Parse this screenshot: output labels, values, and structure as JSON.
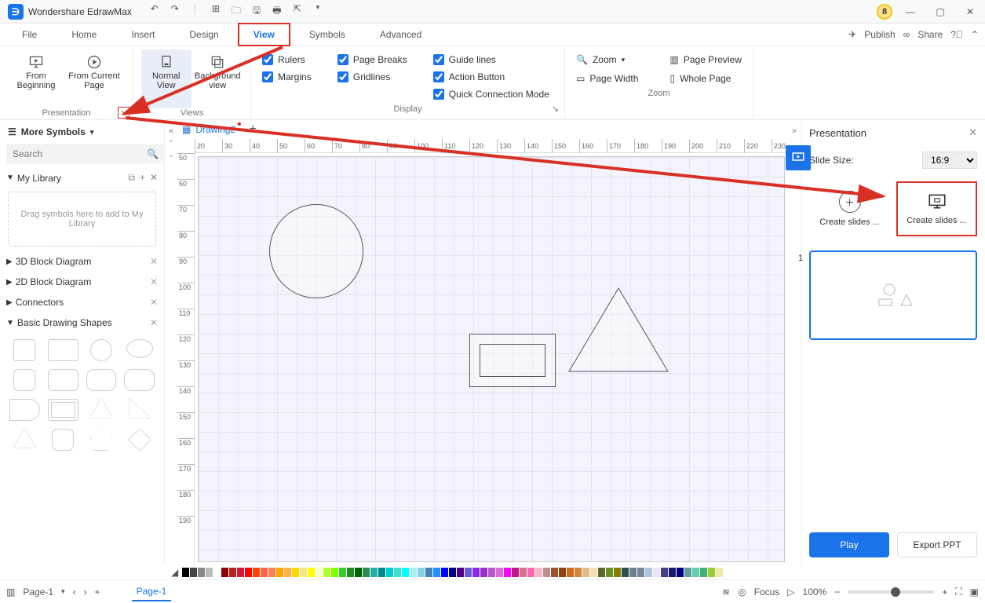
{
  "app_title": "Wondershare EdrawMax",
  "badge": "8",
  "qat": [
    "↶",
    "↷",
    "│",
    "▣",
    "🗂",
    "💾",
    "🖨",
    "↗",
    "▾"
  ],
  "menu": {
    "items": [
      "File",
      "Home",
      "Insert",
      "Design",
      "View",
      "Symbols",
      "Advanced"
    ],
    "active": "View",
    "publish": "Publish",
    "share": "Share"
  },
  "ribbon": {
    "presentation": {
      "title": "Presentation",
      "from_beginning": "From Beginning",
      "from_current": "From Current Page"
    },
    "views": {
      "title": "Views",
      "normal": "Normal View",
      "background": "Background view"
    },
    "display": {
      "title": "Display",
      "rulers": "Rulers",
      "page_breaks": "Page Breaks",
      "guide_lines": "Guide lines",
      "margins": "Margins",
      "gridlines": "Gridlines",
      "action_button": "Action Button",
      "quick_conn": "Quick Connection Mode"
    },
    "zoom": {
      "title": "Zoom",
      "zoom": "Zoom",
      "page_preview": "Page Preview",
      "page_width": "Page Width",
      "whole_page": "Whole Page"
    }
  },
  "sidebar": {
    "more_symbols": "More Symbols",
    "search_placeholder": "Search",
    "my_library": "My Library",
    "drop_hint": "Drag symbols here to add to My Library",
    "categories": [
      "3D Block Diagram",
      "2D Block Diagram",
      "Connectors",
      "Basic Drawing Shapes"
    ]
  },
  "doc_tab": "Drawing2",
  "ruler_h": [
    20,
    30,
    40,
    50,
    60,
    70,
    80,
    90,
    100,
    110,
    120,
    130,
    140,
    150,
    160,
    170,
    180,
    190,
    200,
    210,
    220,
    230
  ],
  "ruler_v": [
    50,
    60,
    70,
    80,
    90,
    100,
    110,
    120,
    130,
    140,
    150,
    160,
    170,
    180,
    190
  ],
  "right": {
    "title": "Presentation",
    "slide_size_label": "Slide Size:",
    "slide_size_value": "16:9",
    "create_manual": "Create slides ...",
    "create_auto": "Create slides ...",
    "slide_num": "1",
    "play": "Play",
    "export": "Export PPT"
  },
  "status": {
    "page_sel": "Page-1",
    "page_tab": "Page-1",
    "focus": "Focus",
    "zoom_pct": "100%"
  },
  "swatches": [
    "#000",
    "#444",
    "#888",
    "#bbb",
    "#fff",
    "#8b0000",
    "#b22222",
    "#dc143c",
    "#ff0000",
    "#ff4500",
    "#ff6347",
    "#ff7f50",
    "#ffa500",
    "#ffb347",
    "#ffd700",
    "#f0e68c",
    "#ffff00",
    "#fafad2",
    "#adff2f",
    "#7fff00",
    "#32cd32",
    "#228b22",
    "#006400",
    "#2e8b57",
    "#20b2aa",
    "#008b8b",
    "#00ced1",
    "#40e0d0",
    "#00ffff",
    "#afeeee",
    "#87ceeb",
    "#4682b4",
    "#1e90ff",
    "#0000ff",
    "#00008b",
    "#4b0082",
    "#6a5acd",
    "#8a2be2",
    "#9932cc",
    "#ba55d3",
    "#da70d6",
    "#ff00ff",
    "#c71585",
    "#db7093",
    "#ff69b4",
    "#ffb6c1",
    "#bc8f8f",
    "#a0522d",
    "#8b4513",
    "#d2691e",
    "#cd853f",
    "#deb887",
    "#f5deb3",
    "#556b2f",
    "#6b8e23",
    "#808000",
    "#2f4f4f",
    "#708090",
    "#778899",
    "#b0c4de",
    "#e6e6fa",
    "#483d8b",
    "#191970",
    "#000080",
    "#5f9ea0",
    "#66cdaa",
    "#3cb371",
    "#9acd32",
    "#eee8aa"
  ]
}
